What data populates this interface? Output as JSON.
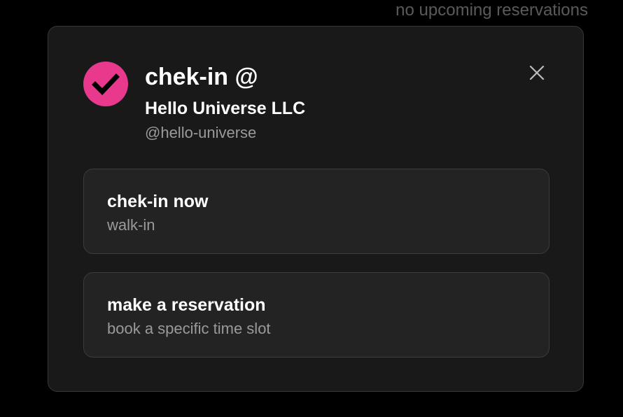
{
  "background": {
    "status_text": "no upcoming reservations"
  },
  "dialog": {
    "logo_icon": "checkmark-icon",
    "title": "chek-in @",
    "org_name": "Hello Universe LLC",
    "org_handle": "@hello-universe",
    "close_icon": "close-icon",
    "options": [
      {
        "title": "chek-in now",
        "subtitle": "walk-in"
      },
      {
        "title": "make a reservation",
        "subtitle": "book a specific time slot"
      }
    ]
  },
  "colors": {
    "accent": "#e8398d",
    "dialog_bg": "#191919",
    "option_bg": "#232323",
    "muted_text": "#9a9a9a"
  }
}
